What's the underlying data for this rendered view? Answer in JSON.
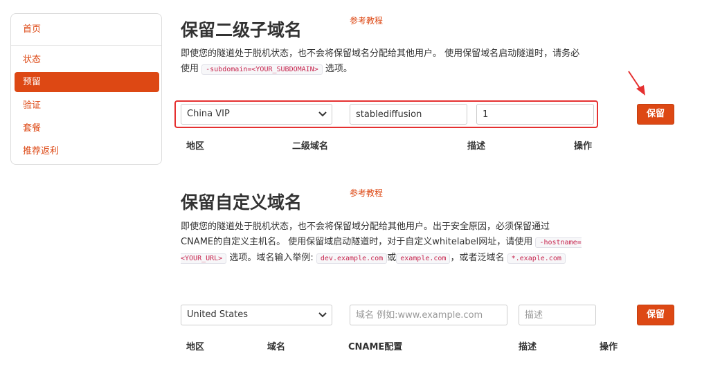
{
  "sidebar": {
    "items": [
      {
        "label": "首页",
        "active": false
      },
      {
        "label": "状态",
        "active": false
      },
      {
        "label": "预留",
        "active": true
      },
      {
        "label": "验证",
        "active": false
      },
      {
        "label": "套餐",
        "active": false
      },
      {
        "label": "推荐返利",
        "active": false
      }
    ]
  },
  "subdomain": {
    "title": "保留二级子域名",
    "ref_link": "参考教程",
    "desc_part1": "即使您的隧道处于脱机状态，也不会将保留域名分配给其他用户。 使用保留域名启动隧道时，请务必使用",
    "desc_code": "-subdomain=<YOUR_SUBDOMAIN>",
    "desc_part2": "选项。",
    "region_value": "China VIP",
    "subdomain_value": "stablediffusion",
    "desc_value": "1",
    "save_label": "保留",
    "headers": [
      "地区",
      "二级域名",
      "描述",
      "操作"
    ]
  },
  "custom": {
    "title": "保留自定义域名",
    "ref_link": "参考教程",
    "desc_part1": "即使您的隧道处于脱机状态，也不会将保留域分配给其他用户。出于安全原因，必须保留通过CNAME的自定义主机名。 使用保留域启动隧道时，对于自定义whitelabel网址，请使用",
    "desc_code1": "-hostname=<YOUR_URL>",
    "desc_part2": "选项。域名输入举例:",
    "desc_code2": "dev.example.com",
    "desc_part3": "或",
    "desc_code3": "example.com",
    "desc_part4": "，或者泛域名",
    "desc_code4": "*.exaple.com",
    "region_value": "United States",
    "domain_placeholder": "域名 例如:www.example.com",
    "desc_placeholder": "描述",
    "save_label": "保留",
    "headers": [
      "地区",
      "域名",
      "CNAME配置",
      "描述",
      "操作"
    ]
  },
  "colors": {
    "accent": "#dd4814",
    "highlight_box": "#e53030"
  },
  "icons": [
    "chevron-down-icon",
    "red-arrow-icon"
  ]
}
